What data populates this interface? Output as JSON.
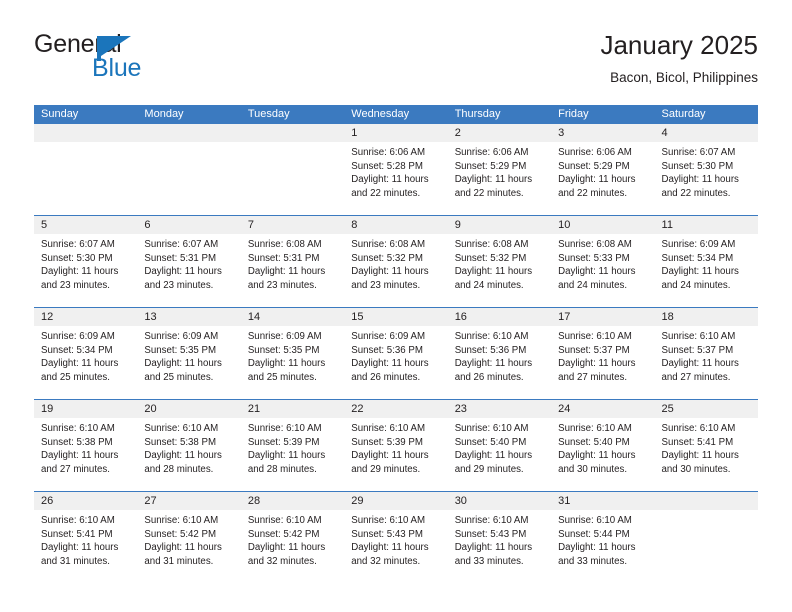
{
  "brand": {
    "name_part1": "General",
    "name_part2": "Blue",
    "logo_icon": "blue-flag-triangle-icon",
    "accent_color": "#1b75bb"
  },
  "header": {
    "title": "January 2025",
    "subtitle": "Bacon, Bicol, Philippines"
  },
  "calendar": {
    "header_color": "#3b7ac0",
    "date_band_color": "#f0f0f0",
    "weekdays": [
      "Sunday",
      "Monday",
      "Tuesday",
      "Wednesday",
      "Thursday",
      "Friday",
      "Saturday"
    ],
    "weeks": [
      [
        {
          "day": "",
          "empty": true,
          "sunrise": "",
          "sunset": "",
          "daylight1": "",
          "daylight2": ""
        },
        {
          "day": "",
          "empty": true,
          "sunrise": "",
          "sunset": "",
          "daylight1": "",
          "daylight2": ""
        },
        {
          "day": "",
          "empty": true,
          "sunrise": "",
          "sunset": "",
          "daylight1": "",
          "daylight2": ""
        },
        {
          "day": "1",
          "empty": false,
          "sunrise": "Sunrise: 6:06 AM",
          "sunset": "Sunset: 5:28 PM",
          "daylight1": "Daylight: 11 hours",
          "daylight2": "and 22 minutes."
        },
        {
          "day": "2",
          "empty": false,
          "sunrise": "Sunrise: 6:06 AM",
          "sunset": "Sunset: 5:29 PM",
          "daylight1": "Daylight: 11 hours",
          "daylight2": "and 22 minutes."
        },
        {
          "day": "3",
          "empty": false,
          "sunrise": "Sunrise: 6:06 AM",
          "sunset": "Sunset: 5:29 PM",
          "daylight1": "Daylight: 11 hours",
          "daylight2": "and 22 minutes."
        },
        {
          "day": "4",
          "empty": false,
          "sunrise": "Sunrise: 6:07 AM",
          "sunset": "Sunset: 5:30 PM",
          "daylight1": "Daylight: 11 hours",
          "daylight2": "and 22 minutes."
        }
      ],
      [
        {
          "day": "5",
          "empty": false,
          "sunrise": "Sunrise: 6:07 AM",
          "sunset": "Sunset: 5:30 PM",
          "daylight1": "Daylight: 11 hours",
          "daylight2": "and 23 minutes."
        },
        {
          "day": "6",
          "empty": false,
          "sunrise": "Sunrise: 6:07 AM",
          "sunset": "Sunset: 5:31 PM",
          "daylight1": "Daylight: 11 hours",
          "daylight2": "and 23 minutes."
        },
        {
          "day": "7",
          "empty": false,
          "sunrise": "Sunrise: 6:08 AM",
          "sunset": "Sunset: 5:31 PM",
          "daylight1": "Daylight: 11 hours",
          "daylight2": "and 23 minutes."
        },
        {
          "day": "8",
          "empty": false,
          "sunrise": "Sunrise: 6:08 AM",
          "sunset": "Sunset: 5:32 PM",
          "daylight1": "Daylight: 11 hours",
          "daylight2": "and 23 minutes."
        },
        {
          "day": "9",
          "empty": false,
          "sunrise": "Sunrise: 6:08 AM",
          "sunset": "Sunset: 5:32 PM",
          "daylight1": "Daylight: 11 hours",
          "daylight2": "and 24 minutes."
        },
        {
          "day": "10",
          "empty": false,
          "sunrise": "Sunrise: 6:08 AM",
          "sunset": "Sunset: 5:33 PM",
          "daylight1": "Daylight: 11 hours",
          "daylight2": "and 24 minutes."
        },
        {
          "day": "11",
          "empty": false,
          "sunrise": "Sunrise: 6:09 AM",
          "sunset": "Sunset: 5:34 PM",
          "daylight1": "Daylight: 11 hours",
          "daylight2": "and 24 minutes."
        }
      ],
      [
        {
          "day": "12",
          "empty": false,
          "sunrise": "Sunrise: 6:09 AM",
          "sunset": "Sunset: 5:34 PM",
          "daylight1": "Daylight: 11 hours",
          "daylight2": "and 25 minutes."
        },
        {
          "day": "13",
          "empty": false,
          "sunrise": "Sunrise: 6:09 AM",
          "sunset": "Sunset: 5:35 PM",
          "daylight1": "Daylight: 11 hours",
          "daylight2": "and 25 minutes."
        },
        {
          "day": "14",
          "empty": false,
          "sunrise": "Sunrise: 6:09 AM",
          "sunset": "Sunset: 5:35 PM",
          "daylight1": "Daylight: 11 hours",
          "daylight2": "and 25 minutes."
        },
        {
          "day": "15",
          "empty": false,
          "sunrise": "Sunrise: 6:09 AM",
          "sunset": "Sunset: 5:36 PM",
          "daylight1": "Daylight: 11 hours",
          "daylight2": "and 26 minutes."
        },
        {
          "day": "16",
          "empty": false,
          "sunrise": "Sunrise: 6:10 AM",
          "sunset": "Sunset: 5:36 PM",
          "daylight1": "Daylight: 11 hours",
          "daylight2": "and 26 minutes."
        },
        {
          "day": "17",
          "empty": false,
          "sunrise": "Sunrise: 6:10 AM",
          "sunset": "Sunset: 5:37 PM",
          "daylight1": "Daylight: 11 hours",
          "daylight2": "and 27 minutes."
        },
        {
          "day": "18",
          "empty": false,
          "sunrise": "Sunrise: 6:10 AM",
          "sunset": "Sunset: 5:37 PM",
          "daylight1": "Daylight: 11 hours",
          "daylight2": "and 27 minutes."
        }
      ],
      [
        {
          "day": "19",
          "empty": false,
          "sunrise": "Sunrise: 6:10 AM",
          "sunset": "Sunset: 5:38 PM",
          "daylight1": "Daylight: 11 hours",
          "daylight2": "and 27 minutes."
        },
        {
          "day": "20",
          "empty": false,
          "sunrise": "Sunrise: 6:10 AM",
          "sunset": "Sunset: 5:38 PM",
          "daylight1": "Daylight: 11 hours",
          "daylight2": "and 28 minutes."
        },
        {
          "day": "21",
          "empty": false,
          "sunrise": "Sunrise: 6:10 AM",
          "sunset": "Sunset: 5:39 PM",
          "daylight1": "Daylight: 11 hours",
          "daylight2": "and 28 minutes."
        },
        {
          "day": "22",
          "empty": false,
          "sunrise": "Sunrise: 6:10 AM",
          "sunset": "Sunset: 5:39 PM",
          "daylight1": "Daylight: 11 hours",
          "daylight2": "and 29 minutes."
        },
        {
          "day": "23",
          "empty": false,
          "sunrise": "Sunrise: 6:10 AM",
          "sunset": "Sunset: 5:40 PM",
          "daylight1": "Daylight: 11 hours",
          "daylight2": "and 29 minutes."
        },
        {
          "day": "24",
          "empty": false,
          "sunrise": "Sunrise: 6:10 AM",
          "sunset": "Sunset: 5:40 PM",
          "daylight1": "Daylight: 11 hours",
          "daylight2": "and 30 minutes."
        },
        {
          "day": "25",
          "empty": false,
          "sunrise": "Sunrise: 6:10 AM",
          "sunset": "Sunset: 5:41 PM",
          "daylight1": "Daylight: 11 hours",
          "daylight2": "and 30 minutes."
        }
      ],
      [
        {
          "day": "26",
          "empty": false,
          "sunrise": "Sunrise: 6:10 AM",
          "sunset": "Sunset: 5:41 PM",
          "daylight1": "Daylight: 11 hours",
          "daylight2": "and 31 minutes."
        },
        {
          "day": "27",
          "empty": false,
          "sunrise": "Sunrise: 6:10 AM",
          "sunset": "Sunset: 5:42 PM",
          "daylight1": "Daylight: 11 hours",
          "daylight2": "and 31 minutes."
        },
        {
          "day": "28",
          "empty": false,
          "sunrise": "Sunrise: 6:10 AM",
          "sunset": "Sunset: 5:42 PM",
          "daylight1": "Daylight: 11 hours",
          "daylight2": "and 32 minutes."
        },
        {
          "day": "29",
          "empty": false,
          "sunrise": "Sunrise: 6:10 AM",
          "sunset": "Sunset: 5:43 PM",
          "daylight1": "Daylight: 11 hours",
          "daylight2": "and 32 minutes."
        },
        {
          "day": "30",
          "empty": false,
          "sunrise": "Sunrise: 6:10 AM",
          "sunset": "Sunset: 5:43 PM",
          "daylight1": "Daylight: 11 hours",
          "daylight2": "and 33 minutes."
        },
        {
          "day": "31",
          "empty": false,
          "sunrise": "Sunrise: 6:10 AM",
          "sunset": "Sunset: 5:44 PM",
          "daylight1": "Daylight: 11 hours",
          "daylight2": "and 33 minutes."
        },
        {
          "day": "",
          "empty": true,
          "sunrise": "",
          "sunset": "",
          "daylight1": "",
          "daylight2": ""
        }
      ]
    ]
  }
}
